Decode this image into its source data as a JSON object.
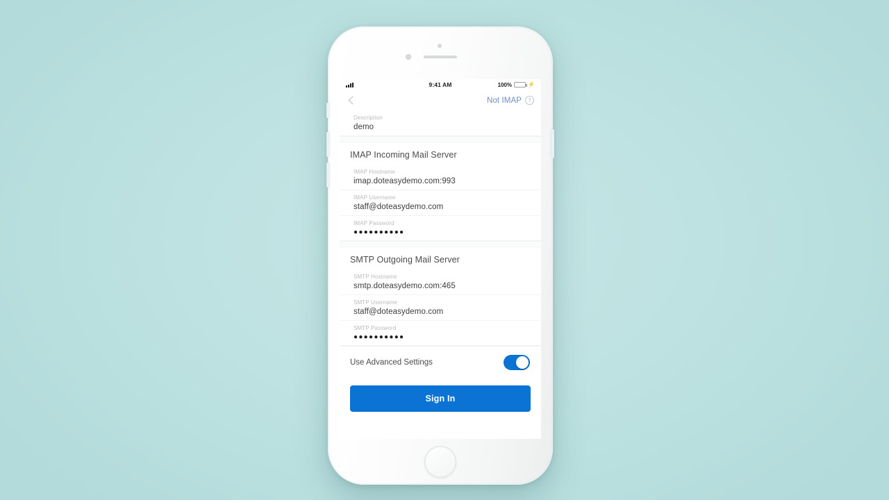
{
  "background_color": "#bde1e1",
  "accent_color": "#0a73d4",
  "status_bar": {
    "signal_icon": "cellular-signal-icon",
    "time": "9:41 AM",
    "battery_percent": "100%",
    "battery_icon": "battery-full-icon",
    "charging_icon": "lightning-bolt-icon"
  },
  "nav_bar": {
    "back_icon": "chevron-left-icon",
    "not_imap_label": "Not IMAP",
    "help_icon": "question-mark-circle-icon",
    "help_glyph": "?"
  },
  "form": {
    "description": {
      "label": "Description",
      "value": "demo"
    },
    "imap_section": {
      "title": "IMAP Incoming Mail Server",
      "fields": [
        {
          "label": "IMAP Hostname",
          "value": "imap.doteasydemo.com:993"
        },
        {
          "label": "IMAP Username",
          "value": "staff@doteasydemo.com"
        },
        {
          "label": "IMAP Password",
          "value": "●●●●●●●●●●"
        }
      ]
    },
    "smtp_section": {
      "title": "SMTP Outgoing Mail Server",
      "fields": [
        {
          "label": "SMTP Hostname",
          "value": "smtp.doteasydemo.com:465"
        },
        {
          "label": "SMTP Username",
          "value": "staff@doteasydemo.com"
        },
        {
          "label": "SMTP Password",
          "value": "●●●●●●●●●●"
        }
      ]
    },
    "advanced_toggle": {
      "label": "Use Advanced Settings",
      "state": "on"
    },
    "submit_button": {
      "label": "Sign In"
    }
  },
  "device": {
    "speaker_icon": "earpiece-speaker-icon",
    "camera_icon": "front-camera-icon",
    "sensor_icon": "proximity-sensor-icon",
    "home_button_icon": "home-button-icon",
    "silent_switch_icon": "silent-switch-icon",
    "volume_up_icon": "volume-up-button-icon",
    "volume_down_icon": "volume-down-button-icon",
    "power_icon": "power-button-icon"
  }
}
